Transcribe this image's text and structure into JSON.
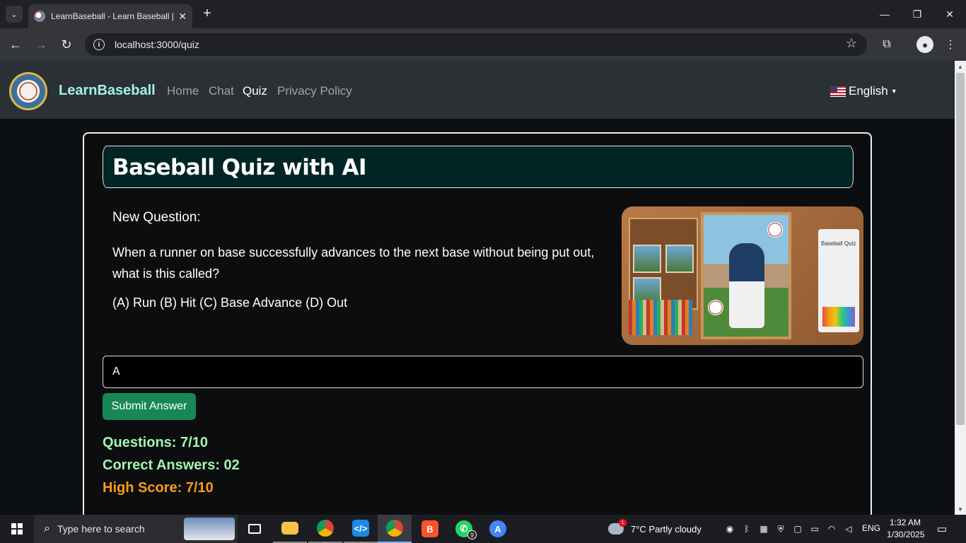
{
  "browser": {
    "tab_title": "LearnBaseball - Learn Baseball |",
    "url": "localhost:3000/quiz"
  },
  "site": {
    "brand": "LearnBaseball",
    "nav": [
      {
        "label": "Home",
        "active": false
      },
      {
        "label": "Chat",
        "active": false
      },
      {
        "label": "Quiz",
        "active": true
      },
      {
        "label": "Privacy Policy",
        "active": false
      }
    ],
    "language": "English"
  },
  "quiz": {
    "title": "Baseball Quiz with AI",
    "question_label": "New Question:",
    "question_text": "When a runner on base successfully advances to the next base without being put out, what is this called?",
    "options_text": "(A) Run (B) Hit (C) Base Advance (D) Out",
    "image_caption": "Baseball Quiz",
    "answer_value": "A",
    "submit_label": "Submit Answer",
    "questions_stat": "Questions: 7/10",
    "correct_stat": "Correct Answers: 02",
    "high_score_stat": "High Score: 7/10"
  },
  "taskbar": {
    "search_placeholder": "Type here to search",
    "whatsapp_badge": "9",
    "weather_alert": "1",
    "weather": "7°C  Partly cloudy",
    "language": "ENG",
    "time": "1:32 AM",
    "date": "1/30/2025"
  },
  "colors": {
    "accent_green": "#198754",
    "brand_teal": "#9ff3ea",
    "stat_green": "#a4f5b2",
    "stat_orange": "#fd9a1c",
    "header_bg": "#012424"
  }
}
